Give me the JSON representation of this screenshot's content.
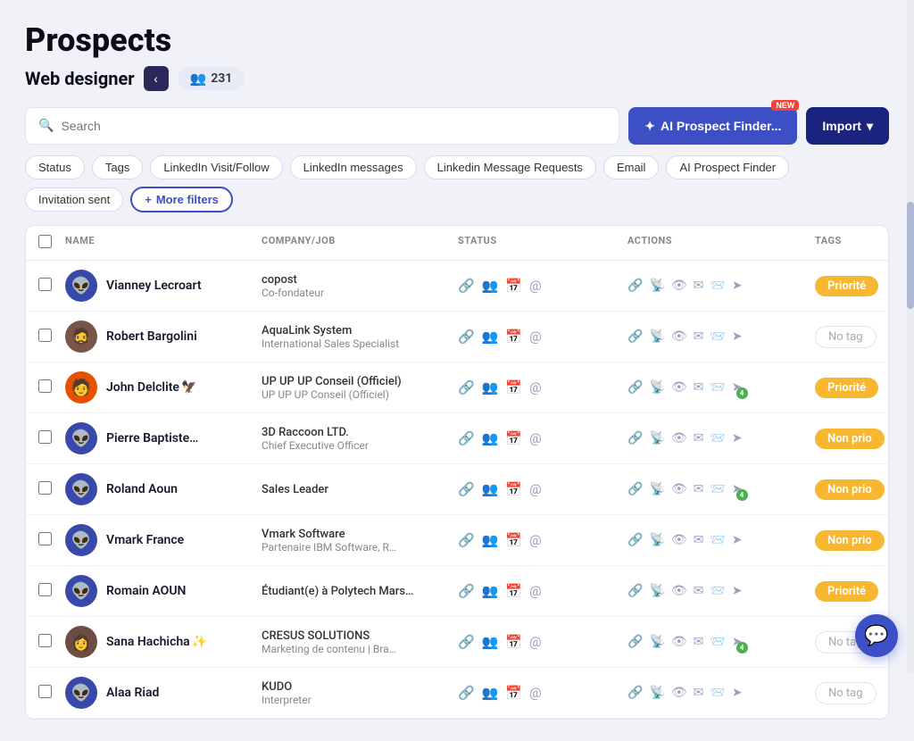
{
  "page": {
    "title": "Prospects",
    "subtitle": "Web designer",
    "back_btn_label": "‹",
    "count": "231",
    "count_icon": "👥"
  },
  "search": {
    "placeholder": "Search"
  },
  "buttons": {
    "ai_label": "AI Prospect Finder...",
    "ai_new": "NEW",
    "ai_icon": "✦",
    "import_label": "Import",
    "import_icon": "▾",
    "more_filters": "More filters",
    "more_filters_icon": "+"
  },
  "filters": [
    "Status",
    "Tags",
    "LinkedIn Visit/Follow",
    "LinkedIn messages",
    "Linkedin Message Requests",
    "Email",
    "AI Prospect Finder",
    "Invitation sent"
  ],
  "table": {
    "headers": [
      "",
      "NAME",
      "COMPANY/JOB",
      "STATUS",
      "ACTIONS",
      "TAGS"
    ],
    "rows": [
      {
        "name": "Vianney Lecroart",
        "avatar_type": "alien",
        "avatar_emoji": "👽",
        "company": "copost",
        "role": "Co-fondateur",
        "tag": "Priorité",
        "tag_type": "priorite",
        "has_action_badge": false,
        "has_action_badge2": false
      },
      {
        "name": "Robert Bargolini",
        "avatar_type": "photo-1",
        "avatar_emoji": "🧔",
        "company": "AquaLink System",
        "role": "International Sales Specialist",
        "tag": "No tag",
        "tag_type": "none",
        "has_action_badge": false,
        "has_action_badge2": false
      },
      {
        "name": "John Delclite",
        "avatar_type": "photo-2",
        "avatar_emoji": "🧑",
        "name_suffix": "🦅",
        "company": "UP UP UP Conseil (Officiel)",
        "role": "UP UP UP Conseil (Officiel)",
        "tag": "Priorité",
        "tag_type": "priorite",
        "has_action_badge": true,
        "badge_num": "4"
      },
      {
        "name": "Pierre Baptiste…",
        "avatar_type": "alien",
        "avatar_emoji": "👽",
        "company": "3D Raccoon LTD.",
        "role": "Chief Executive Officer",
        "tag": "Non prio",
        "tag_type": "non-prio",
        "has_action_badge": false
      },
      {
        "name": "Roland Aoun",
        "avatar_type": "alien",
        "avatar_emoji": "👽",
        "company": "Sales Leader",
        "role": "",
        "tag": "Non prio",
        "tag_type": "non-prio",
        "has_action_badge": true,
        "badge_num": "4"
      },
      {
        "name": "Vmark France",
        "avatar_type": "alien",
        "avatar_emoji": "👽",
        "company": "Vmark Software",
        "role": "Partenaire IBM Software, R…",
        "tag": "Non prio",
        "tag_type": "non-prio",
        "has_action_badge": false,
        "link_color": "orange"
      },
      {
        "name": "Romain AOUN",
        "avatar_type": "alien",
        "avatar_emoji": "👽",
        "company": "Étudiant(e) à Polytech Mars…",
        "role": "",
        "tag": "Priorité",
        "tag_type": "priorite",
        "has_action_badge": false
      },
      {
        "name": "Sana Hachicha",
        "avatar_type": "photo-3",
        "avatar_emoji": "👩",
        "name_suffix": "✨",
        "company": "CRESUS SOLUTIONS",
        "role": "Marketing de contenu | Bra…",
        "tag": "No tag",
        "tag_type": "none",
        "has_action_badge": true,
        "badge_num": "4"
      },
      {
        "name": "Alaa Riad",
        "avatar_type": "alien",
        "avatar_emoji": "👽",
        "company": "KUDO",
        "role": "Interpreter",
        "tag": "No tag",
        "tag_type": "none",
        "has_action_badge": false,
        "link_color": "orange"
      }
    ]
  }
}
